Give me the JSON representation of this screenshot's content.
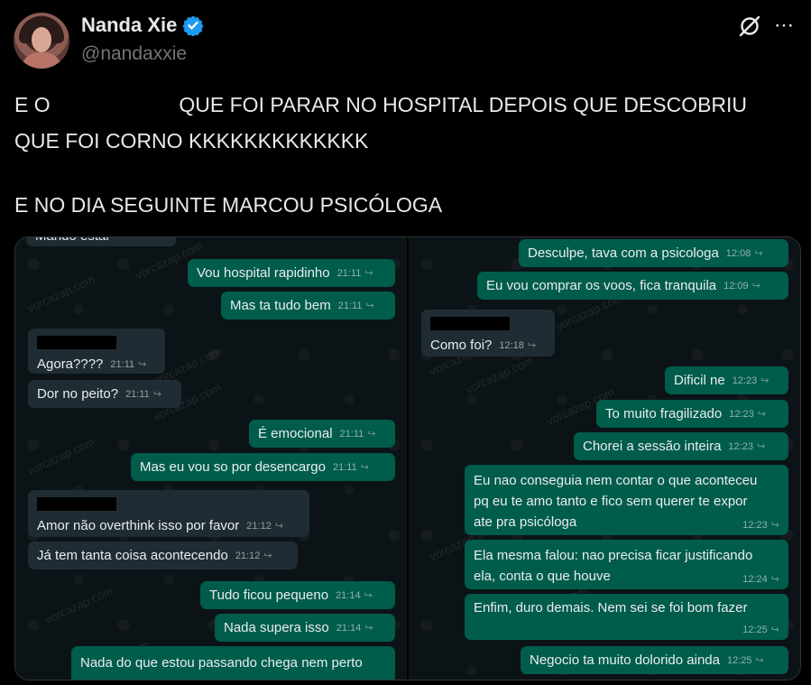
{
  "author": {
    "name": "Nanda Xie",
    "handle": "@nandaxxie"
  },
  "icons": {
    "verified": "verified-badge-icon",
    "grok": "grok-icon",
    "more": "more-options-icon",
    "forward": "forward-arrow-icon"
  },
  "colors": {
    "verified": "#1d9bf0",
    "outgoing": "#005c4b",
    "incoming": "#1f2c34"
  },
  "tweet": {
    "line1_pre": "E O",
    "line1_post": "QUE FOI PARAR NO HOSPITAL DEPOIS QUE DESCOBRIU",
    "line2": "QUE FOI CORNO KKKKKKKKKKKKK",
    "line3": "E NO DIA SEGUINTE MARCOU PSICÓLOGA"
  },
  "watermark": "vorcazap.com",
  "chat_left": [
    {
      "text": "Mando estar",
      "time": "",
      "dir": "in"
    },
    {
      "text": "Vou hospital rapidinho",
      "time": "21:11",
      "dir": "out"
    },
    {
      "text": "Mas ta tudo bem",
      "time": "21:11",
      "dir": "out"
    },
    {
      "text": "Agora????",
      "time": "21:11",
      "dir": "in"
    },
    {
      "text": "Dor no peito?",
      "time": "21:11",
      "dir": "in"
    },
    {
      "text": "É emocional",
      "time": "21:11",
      "dir": "out"
    },
    {
      "text": "Mas eu vou so por desencargo",
      "time": "21:11",
      "dir": "out"
    },
    {
      "text": "Amor não overthink isso por favor",
      "time": "21:12",
      "dir": "in"
    },
    {
      "text": "Já tem tanta coisa acontecendo",
      "time": "21:12",
      "dir": "in"
    },
    {
      "text": "Tudo ficou pequeno",
      "time": "21:14",
      "dir": "out"
    },
    {
      "text": "Nada supera isso",
      "time": "21:14",
      "dir": "out"
    },
    {
      "text": "Nada do que estou passando chega nem perto",
      "time": "",
      "dir": "out"
    }
  ],
  "chat_right": [
    {
      "text": "Desculpe, tava com a psicologa",
      "time": "12:08",
      "dir": "out"
    },
    {
      "text": "Eu vou comprar os voos, fica tranquila",
      "time": "12:09",
      "dir": "out"
    },
    {
      "text": "Como foi?",
      "time": "12:18",
      "dir": "in"
    },
    {
      "text": "Dificil ne",
      "time": "12:23",
      "dir": "out"
    },
    {
      "text": "To muito fragilizado",
      "time": "12:23",
      "dir": "out"
    },
    {
      "text": "Chorei a sessão inteira",
      "time": "12:23",
      "dir": "out"
    },
    {
      "text": "Eu nao conseguia nem contar o que aconteceu\npq eu te amo tanto e fico sem querer te expor\nate pra psicóloga",
      "time": "12:23",
      "dir": "out"
    },
    {
      "text": "Ela mesma falou: nao precisa ficar justificando\nela, conta o que houve",
      "time": "12:24",
      "dir": "out"
    },
    {
      "text": "Enfim, duro demais. Nem sei se foi bom fazer",
      "time": "12:25",
      "dir": "out"
    },
    {
      "text": "Negocio ta muito dolorido ainda",
      "time": "12:25",
      "dir": "out"
    }
  ]
}
